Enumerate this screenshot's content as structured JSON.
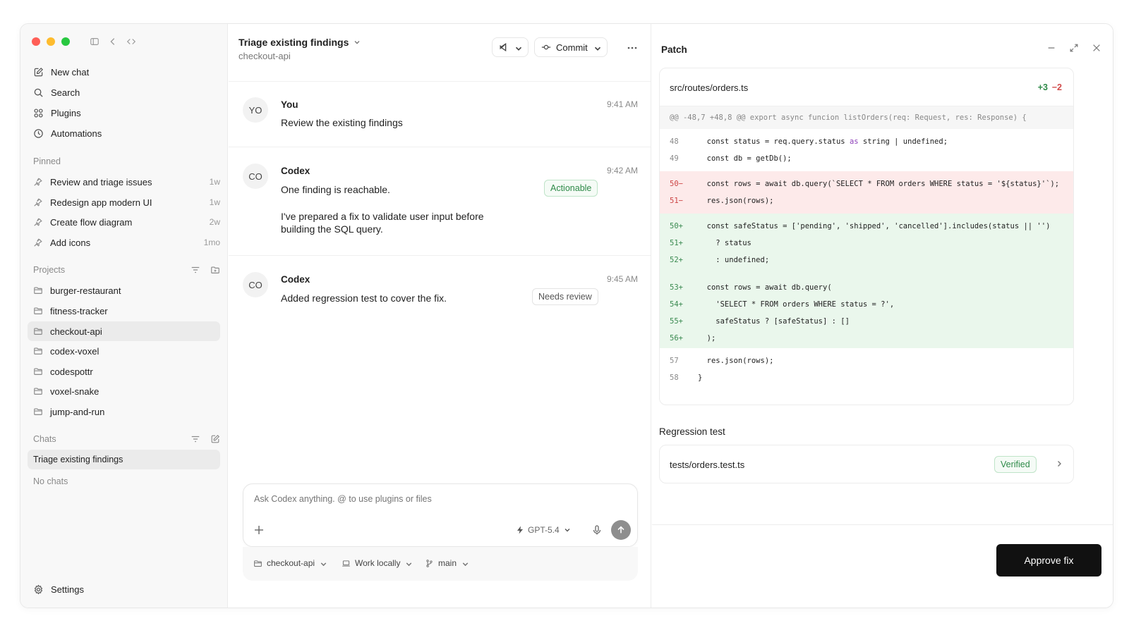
{
  "colors": {
    "traffic_red": "#ff5f57",
    "traffic_yellow": "#febc2e",
    "traffic_green": "#28c840",
    "accent_green": "#2e8a48",
    "accent_red": "#d24b4b",
    "approve_bg": "#111111"
  },
  "sidebar": {
    "nav": [
      {
        "label": "New chat",
        "icon": "compose-icon"
      },
      {
        "label": "Search",
        "icon": "search-icon"
      },
      {
        "label": "Plugins",
        "icon": "plugins-icon"
      },
      {
        "label": "Automations",
        "icon": "clock-icon"
      }
    ],
    "pinned_title": "Pinned",
    "pinned": [
      {
        "label": "Review and triage issues",
        "age": "1w"
      },
      {
        "label": "Redesign app modern UI",
        "age": "1w"
      },
      {
        "label": "Create flow diagram",
        "age": "2w"
      },
      {
        "label": "Add icons",
        "age": "1mo"
      }
    ],
    "projects_title": "Projects",
    "projects": [
      {
        "label": "burger-restaurant"
      },
      {
        "label": "fitness-tracker"
      },
      {
        "label": "checkout-api",
        "active": true
      },
      {
        "label": "codex-voxel"
      },
      {
        "label": "codespottr"
      },
      {
        "label": "voxel-snake"
      },
      {
        "label": "jump-and-run"
      }
    ],
    "chats_title": "Chats",
    "chats": [
      {
        "label": "Triage existing findings"
      }
    ],
    "no_chats": "No chats",
    "settings": "Settings"
  },
  "header": {
    "title": "Triage existing findings",
    "subtitle": "checkout-api",
    "commit_label": "Commit"
  },
  "messages": [
    {
      "avatar": "YO",
      "author": "You",
      "time": "9:41 AM",
      "text": "Review the existing findings"
    },
    {
      "avatar": "CO",
      "author": "Codex",
      "time": "9:42 AM",
      "text": "One finding is reachable.",
      "text2": "I've prepared a fix to validate user input before building the SQL query.",
      "badge": "Actionable"
    },
    {
      "avatar": "CO",
      "author": "Codex",
      "time": "9:45 AM",
      "text": "Added regression test to cover the fix.",
      "badge": "Needs review"
    }
  ],
  "composer": {
    "placeholder": "Ask Codex anything. @ to use plugins or files",
    "model": "GPT-5.4",
    "project": "checkout-api",
    "mode": "Work locally",
    "branch": "main"
  },
  "patch": {
    "title": "Patch",
    "file": "src/routes/orders.ts",
    "additions": "+3",
    "deletions": "−2",
    "hunk": "@@ -48,7 +48,8 @@ export async funcion listOrders(req: Request, res: Response) {",
    "ctx_before": [
      {
        "ln": "48",
        "pre": "  const status = req.query.status ",
        "kw": "as",
        "post": " string | undefined;"
      },
      {
        "ln": "49",
        "pre": "  const db = getDb();",
        "kw": "",
        "post": ""
      }
    ],
    "deleted": [
      {
        "ln": "50−",
        "code": "  const rows = await db.query(`SELECT * FROM orders WHERE status = '${status}'`);"
      },
      {
        "ln": "51−",
        "code": "  res.json(rows);"
      }
    ],
    "added_a": [
      {
        "ln": "50+",
        "code": "  const safeStatus = ['pending', 'shipped', 'cancelled'].includes(status || '')"
      },
      {
        "ln": "51+",
        "code": "    ? status"
      },
      {
        "ln": "52+",
        "code": "    : undefined;"
      }
    ],
    "added_b": [
      {
        "ln": "53+",
        "code": "  const rows = await db.query("
      },
      {
        "ln": "54+",
        "code": "    'SELECT * FROM orders WHERE status = ?',"
      },
      {
        "ln": "55+",
        "code": "    safeStatus ? [safeStatus] : []"
      },
      {
        "ln": "56+",
        "code": "  );"
      }
    ],
    "ctx_after": [
      {
        "ln": "57",
        "code": "  res.json(rows);"
      },
      {
        "ln": "58",
        "code": "}"
      }
    ],
    "regression_title": "Regression test",
    "regression_file": "tests/orders.test.ts",
    "regression_badge": "Verified",
    "approve_label": "Approve fix"
  }
}
